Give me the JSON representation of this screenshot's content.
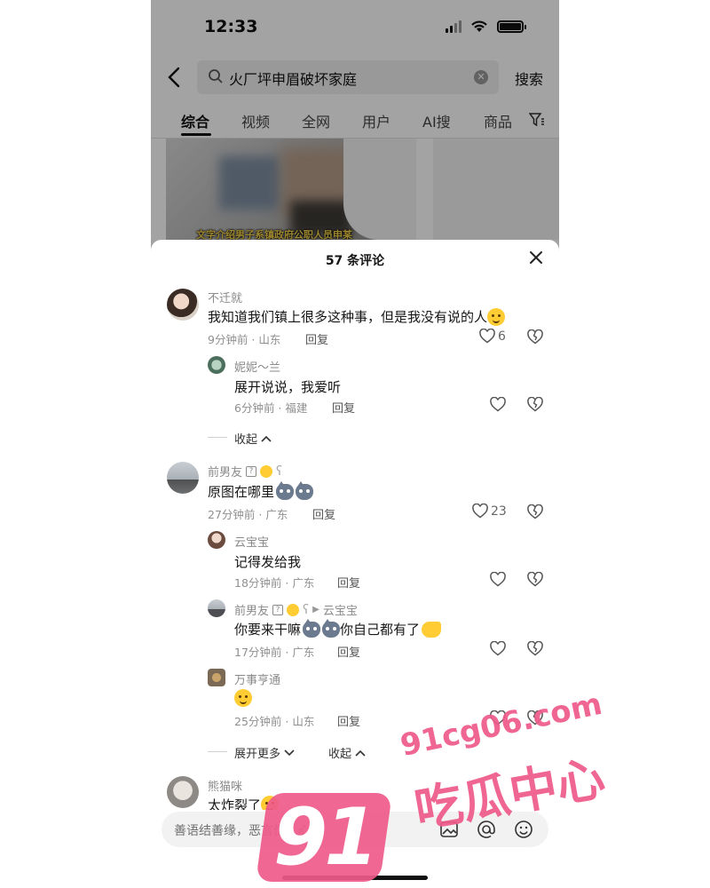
{
  "status_bar": {
    "time": "12:33"
  },
  "search": {
    "query": "火厂坪申眉破坏家庭",
    "submit_label": "搜索"
  },
  "tabs": [
    "综合",
    "视频",
    "全网",
    "用户",
    "AI搜",
    "商品"
  ],
  "active_tab": "综合",
  "video_thumb": {
    "caption": "文字介绍男子系镇政府公职人员申某"
  },
  "comments_sheet": {
    "title": "57 条评论",
    "comments": [
      {
        "user": "不迁就",
        "text": "我知道我们镇上很多这种事，但是我没有说的人",
        "meta": "9分钟前 · 山东",
        "reply_label": "回复",
        "likes": "6",
        "replies": [
          {
            "user": "妮妮～兰",
            "text": "展开说说，我爱听",
            "meta": "6分钟前 · 福建",
            "reply_label": "回复"
          }
        ],
        "collapse_label": "收起"
      },
      {
        "user": "前男友",
        "text": "原图在哪里",
        "meta": "27分钟前 · 广东",
        "reply_label": "回复",
        "likes": "23",
        "replies": [
          {
            "user": "云宝宝",
            "text": "记得发给我",
            "meta": "18分钟前 · 广东",
            "reply_label": "回复"
          },
          {
            "user": "前男友",
            "reply_to": "云宝宝",
            "text_a": "你要来干嘛",
            "text_b": "你自己都有了",
            "meta": "17分钟前 · 广东",
            "reply_label": "回复"
          },
          {
            "user": "万事亨通",
            "text": "",
            "meta": "25分钟前 · 山东",
            "reply_label": "回复"
          }
        ],
        "expand_label": "展开更多",
        "collapse_label": "收起"
      },
      {
        "user": "熊猫咪",
        "text": "太炸裂了"
      }
    ]
  },
  "input_bar": {
    "placeholder": "善语结善缘，恶言伤人心"
  },
  "watermark": {
    "url": "91cg06.com",
    "logo_number": "91",
    "logo_text": "吃瓜中心"
  },
  "colors": {
    "watermark_pink": "#ef5a8a",
    "text_primary": "#161616",
    "text_meta": "#8f8f8f"
  }
}
